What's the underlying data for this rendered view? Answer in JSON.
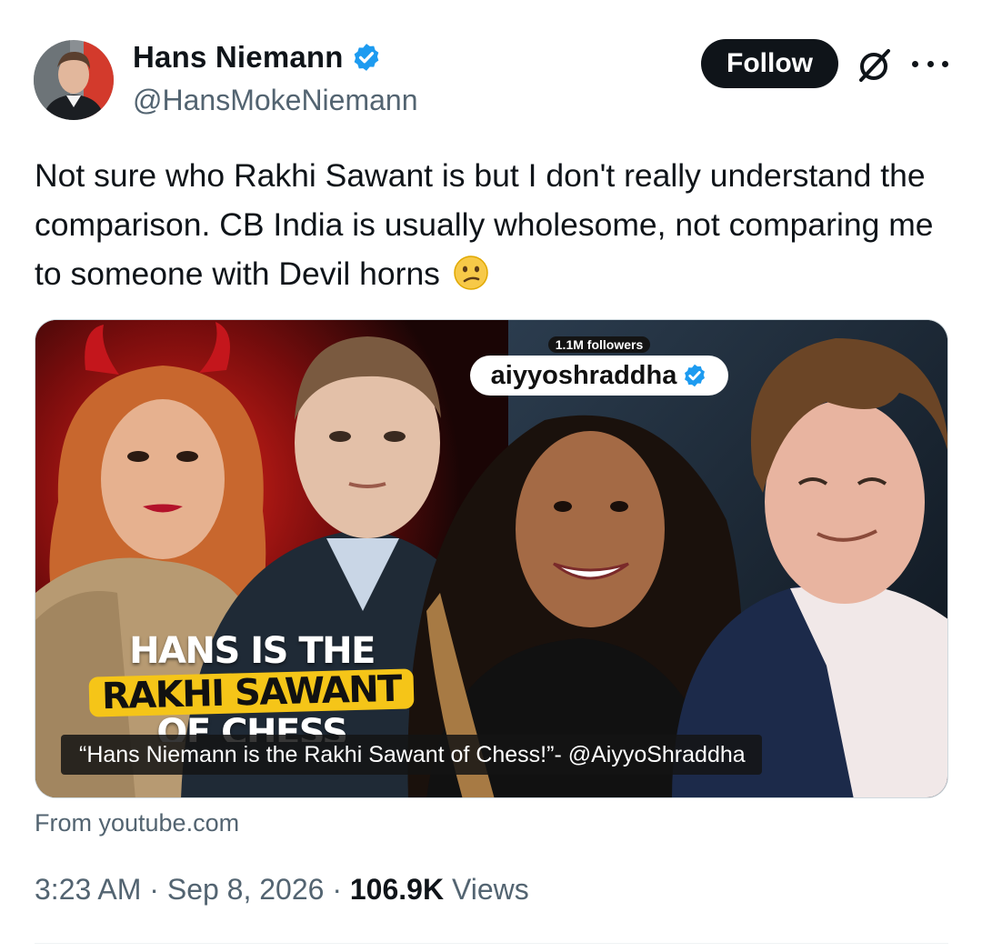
{
  "author": {
    "display_name": "Hans Niemann",
    "handle": "@HansMokeNiemann",
    "verified": true
  },
  "actions": {
    "follow_label": "Follow"
  },
  "icons": {
    "verified": "verified-badge-icon",
    "grok": "grok-icon",
    "more": "more-options-icon",
    "emoji": "confused-face-emoji"
  },
  "tweet": {
    "text": "Not sure who Rakhi Sawant is but I don't really understand the comparison. CB India is usually wholesome, not comparing me to someone with Devil horns",
    "emoji": "😕"
  },
  "media": {
    "badge_followers": "1.1M followers",
    "badge_name": "aiyyoshraddha",
    "thumbnail_title": [
      "HANS IS THE",
      "RAKHI SAWANT",
      "OF CHESS"
    ],
    "caption": "“Hans Niemann is the Rakhi Sawant of Chess!”- @AiyyoShraddha",
    "source": "From youtube.com"
  },
  "meta": {
    "time": "3:23 AM",
    "separator": " · ",
    "date": "Sep 8, 2026",
    "views_count": "106.9K",
    "views_label": " Views"
  },
  "colors": {
    "verified_blue": "#1d9bf0",
    "text_primary": "#0f1419",
    "text_secondary": "#536471",
    "accent_yellow": "#f5c518"
  }
}
